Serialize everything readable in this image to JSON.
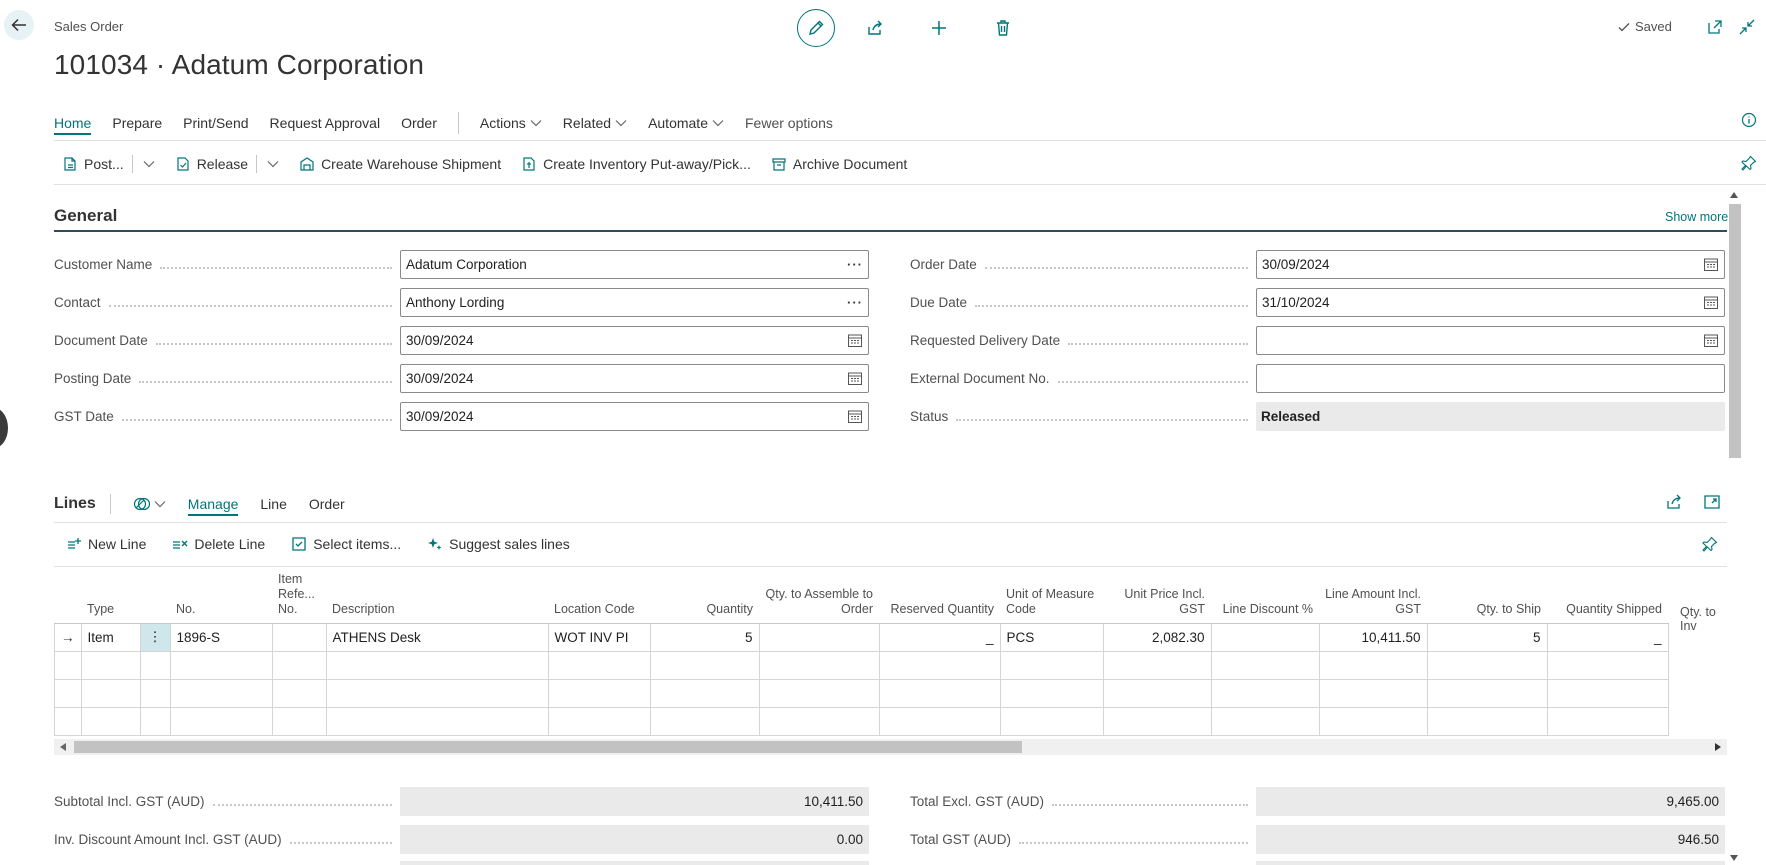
{
  "header": {
    "breadcrumb": "Sales Order",
    "title": "101034 · Adatum Corporation",
    "status": "Saved"
  },
  "menu": {
    "tabs": [
      "Home",
      "Prepare",
      "Print/Send",
      "Request Approval",
      "Order"
    ],
    "dropdowns": [
      "Actions",
      "Related",
      "Automate"
    ],
    "fewer": "Fewer options"
  },
  "actions": {
    "post": "Post...",
    "release": "Release",
    "create_shipment": "Create Warehouse Shipment",
    "create_putaway": "Create Inventory Put-away/Pick...",
    "archive": "Archive Document"
  },
  "general": {
    "title": "General",
    "show_more": "Show more",
    "customer_name": {
      "label": "Customer Name",
      "value": "Adatum Corporation"
    },
    "contact": {
      "label": "Contact",
      "value": "Anthony Lording"
    },
    "document_date": {
      "label": "Document Date",
      "value": "30/09/2024"
    },
    "posting_date": {
      "label": "Posting Date",
      "value": "30/09/2024"
    },
    "gst_date": {
      "label": "GST Date",
      "value": "30/09/2024"
    },
    "order_date": {
      "label": "Order Date",
      "value": "30/09/2024"
    },
    "due_date": {
      "label": "Due Date",
      "value": "31/10/2024"
    },
    "requested_delivery_date": {
      "label": "Requested Delivery Date",
      "value": ""
    },
    "external_doc_no": {
      "label": "External Document No.",
      "value": ""
    },
    "status": {
      "label": "Status",
      "value": "Released"
    }
  },
  "lines": {
    "title": "Lines",
    "tabs": [
      "Manage",
      "Line",
      "Order"
    ],
    "actions": {
      "new_line": "New Line",
      "delete_line": "Delete Line",
      "select_items": "Select items...",
      "suggest": "Suggest sales lines"
    },
    "columns": {
      "type": "Type",
      "no": "No.",
      "item_ref": "Item Refe... No.",
      "description": "Description",
      "location": "Location Code",
      "quantity": "Quantity",
      "qty_assemble": "Qty. to Assemble to Order",
      "reserved": "Reserved Quantity",
      "uom": "Unit of Measure Code",
      "unit_price": "Unit Price Incl. GST",
      "discount": "Line Discount %",
      "line_amount": "Line Amount Incl. GST",
      "qty_ship": "Qty. to Ship",
      "qty_shipped": "Quantity Shipped",
      "qty_invoice": "Qty. to Inv"
    },
    "row": {
      "type": "Item",
      "no": "1896-S",
      "item_ref": "",
      "description": "ATHENS Desk",
      "location": "WOT INV PI",
      "quantity": "5",
      "qty_assemble": "",
      "reserved": "_",
      "uom": "PCS",
      "unit_price": "2,082.30",
      "discount": "",
      "line_amount": "10,411.50",
      "qty_ship": "5",
      "qty_shipped": "_",
      "qty_invoice": ""
    }
  },
  "totals": {
    "subtotal": {
      "label": "Subtotal Incl. GST (AUD)",
      "value": "10,411.50"
    },
    "inv_discount": {
      "label": "Inv. Discount Amount Incl. GST (AUD)",
      "value": "0.00"
    },
    "total_excl": {
      "label": "Total Excl. GST (AUD)",
      "value": "9,465.00"
    },
    "total_gst": {
      "label": "Total GST (AUD)",
      "value": "946.50"
    }
  },
  "colors": {
    "accent": "#00767a",
    "heading_rule": "#2a4f5a",
    "readonly_bg": "#eaeaea"
  }
}
